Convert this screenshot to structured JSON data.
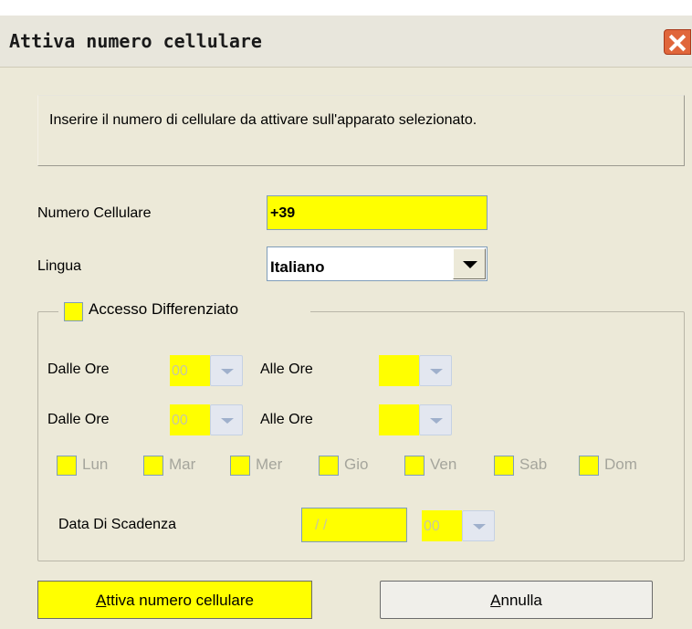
{
  "window": {
    "title": "Attiva numero cellulare",
    "close_icon": "close-icon"
  },
  "info": {
    "text": "Inserire il numero di cellulare da attivare sull'apparato selezionato."
  },
  "form": {
    "phone_label": "Numero Cellulare",
    "phone_value": "+39",
    "language_label": "Lingua",
    "language_value": "Italiano"
  },
  "access": {
    "checkbox_label": "Accesso Differenziato",
    "checked": false,
    "rows": [
      {
        "from_label": "Dalle Ore",
        "from_value": "00",
        "to_label": "Alle Ore",
        "to_value": ""
      },
      {
        "from_label": "Dalle Ore",
        "from_value": "00",
        "to_label": "Alle Ore",
        "to_value": ""
      }
    ],
    "days": [
      "Lun",
      "Mar",
      "Mer",
      "Gio",
      "Ven",
      "Sab",
      "Dom"
    ],
    "expiry_label": "Data Di Scadenza",
    "expiry_date": " / /",
    "expiry_hour": "00"
  },
  "buttons": {
    "activate_mnemonic": "A",
    "activate_rest": "ttiva numero cellulare",
    "cancel_mnemonic": "A",
    "cancel_rest": "nnulla"
  },
  "colors": {
    "required_field": "#ffff00",
    "dialog_bg": "#ece9d8",
    "close_button": "#e0663b"
  }
}
